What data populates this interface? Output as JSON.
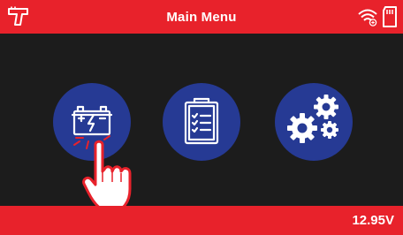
{
  "header": {
    "title": "Main Menu",
    "left_icon": "tester-gun-icon",
    "right_icons": [
      "wifi-icon",
      "sd-card-icon"
    ]
  },
  "menu": {
    "items": [
      {
        "name": "battery-test",
        "icon": "battery-spark-icon"
      },
      {
        "name": "checklist",
        "icon": "clipboard-checklist-icon"
      },
      {
        "name": "settings",
        "icon": "gears-icon"
      }
    ],
    "selected_hint_icon": "tap-hand-icon"
  },
  "footer": {
    "voltage": "12.95V"
  },
  "colors": {
    "bar_red": "#e8222b",
    "background": "#1c1c1c",
    "button_blue": "#263a94"
  }
}
